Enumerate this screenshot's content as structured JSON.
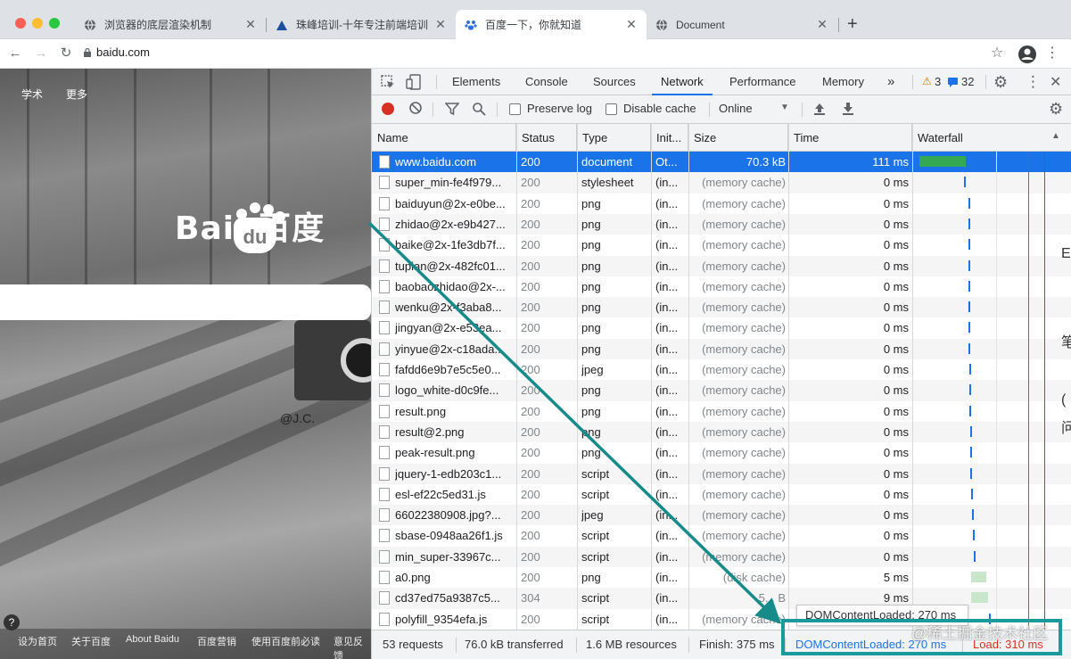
{
  "browser": {
    "tabs": [
      {
        "title": "浏览器的底层渲染机制",
        "icon": "globe-icon",
        "active": false
      },
      {
        "title": "珠峰培训-十年专注前端培训, 有",
        "icon": "mountain-icon",
        "active": false
      },
      {
        "title": "百度一下，你就知道",
        "icon": "paw-icon",
        "active": true
      },
      {
        "title": "Document",
        "icon": "globe-icon",
        "active": false
      }
    ],
    "new_tab": "+",
    "url": "baidu.com"
  },
  "page": {
    "nav": [
      "学术",
      "更多"
    ],
    "logo_text": "Bai  百度",
    "logo_du": "du",
    "signature": "@J.C.",
    "footer": [
      "设为首页",
      "关于百度",
      "About Baidu",
      "百度营销",
      "使用百度前必读",
      "意见反馈"
    ],
    "help": "?"
  },
  "devtools": {
    "tabs": [
      "Elements",
      "Console",
      "Sources",
      "Network",
      "Performance",
      "Memory"
    ],
    "active_tab": "Network",
    "more": "»",
    "warnings": "3",
    "messages": "32",
    "toolbar": {
      "preserve_log": "Preserve log",
      "disable_cache": "Disable cache",
      "throttle": "Online"
    },
    "columns": [
      "Name",
      "Status",
      "Type",
      "Init...",
      "Size",
      "Time",
      "Waterfall"
    ],
    "requests": [
      {
        "name": "www.baidu.com",
        "status": "200",
        "type": "document",
        "init": "Ot...",
        "size": "70.3 kB",
        "time": "111 ms"
      },
      {
        "name": "super_min-fe4f979...",
        "status": "200",
        "type": "stylesheet",
        "init": "(in...",
        "size": "(memory cache)",
        "time": "0 ms"
      },
      {
        "name": "baiduyun@2x-e0be...",
        "status": "200",
        "type": "png",
        "init": "(in...",
        "size": "(memory cache)",
        "time": "0 ms"
      },
      {
        "name": "zhidao@2x-e9b427...",
        "status": "200",
        "type": "png",
        "init": "(in...",
        "size": "(memory cache)",
        "time": "0 ms"
      },
      {
        "name": "baike@2x-1fe3db7f...",
        "status": "200",
        "type": "png",
        "init": "(in...",
        "size": "(memory cache)",
        "time": "0 ms"
      },
      {
        "name": "tupian@2x-482fc01...",
        "status": "200",
        "type": "png",
        "init": "(in...",
        "size": "(memory cache)",
        "time": "0 ms"
      },
      {
        "name": "baobaozhidao@2x-...",
        "status": "200",
        "type": "png",
        "init": "(in...",
        "size": "(memory cache)",
        "time": "0 ms"
      },
      {
        "name": "wenku@2x-f3aba8...",
        "status": "200",
        "type": "png",
        "init": "(in...",
        "size": "(memory cache)",
        "time": "0 ms"
      },
      {
        "name": "jingyan@2x-e53ea...",
        "status": "200",
        "type": "png",
        "init": "(in...",
        "size": "(memory cache)",
        "time": "0 ms"
      },
      {
        "name": "yinyue@2x-c18ada...",
        "status": "200",
        "type": "png",
        "init": "(in...",
        "size": "(memory cache)",
        "time": "0 ms"
      },
      {
        "name": "fafdd6e9b7e5c5e0...",
        "status": "200",
        "type": "jpeg",
        "init": "(in...",
        "size": "(memory cache)",
        "time": "0 ms"
      },
      {
        "name": "logo_white-d0c9fe...",
        "status": "200",
        "type": "png",
        "init": "(in...",
        "size": "(memory cache)",
        "time": "0 ms"
      },
      {
        "name": "result.png",
        "status": "200",
        "type": "png",
        "init": "(in...",
        "size": "(memory cache)",
        "time": "0 ms"
      },
      {
        "name": "result@2.png",
        "status": "200",
        "type": "png",
        "init": "(in...",
        "size": "(memory cache)",
        "time": "0 ms"
      },
      {
        "name": "peak-result.png",
        "status": "200",
        "type": "png",
        "init": "(in...",
        "size": "(memory cache)",
        "time": "0 ms"
      },
      {
        "name": "jquery-1-edb203c1...",
        "status": "200",
        "type": "script",
        "init": "(in...",
        "size": "(memory cache)",
        "time": "0 ms"
      },
      {
        "name": "esl-ef22c5ed31.js",
        "status": "200",
        "type": "script",
        "init": "(in...",
        "size": "(memory cache)",
        "time": "0 ms"
      },
      {
        "name": "66022380908.jpg?...",
        "status": "200",
        "type": "jpeg",
        "init": "(in...",
        "size": "(memory cache)",
        "time": "0 ms"
      },
      {
        "name": "sbase-0948aa26f1.js",
        "status": "200",
        "type": "script",
        "init": "(in...",
        "size": "(memory cache)",
        "time": "0 ms"
      },
      {
        "name": "min_super-33967c...",
        "status": "200",
        "type": "script",
        "init": "(in...",
        "size": "(memory cache)",
        "time": "0 ms"
      },
      {
        "name": "a0.png",
        "status": "200",
        "type": "png",
        "init": "(in...",
        "size": "(disk cache)",
        "time": "5 ms"
      },
      {
        "name": "cd37ed75a9387c5...",
        "status": "304",
        "type": "script",
        "init": "(in...",
        "size": "5... B",
        "time": "9 ms"
      },
      {
        "name": "polyfill_9354efa.js",
        "status": "200",
        "type": "script",
        "init": "(in...",
        "size": "(memory cache)",
        "time": "0 ms"
      }
    ],
    "status_bar": {
      "requests": "53 requests",
      "transferred": "76.0 kB transferred",
      "resources": "1.6 MB resources",
      "finish": "Finish: 375 ms",
      "dom_content_loaded": "DOMContentLoaded: 270 ms",
      "load": "Load: 310 ms"
    },
    "tooltip": "DOMContentLoaded: 270 ms"
  },
  "overlay": {
    "watermark": "@稀土掘金技术社区",
    "side_chars": [
      "E",
      "笔",
      "(",
      "问"
    ]
  },
  "colors": {
    "accent": "#1a73e8",
    "record": "#d93025",
    "highlight": "#1a9a9a",
    "dcl": "#1a73e8",
    "load": "#d93025"
  }
}
